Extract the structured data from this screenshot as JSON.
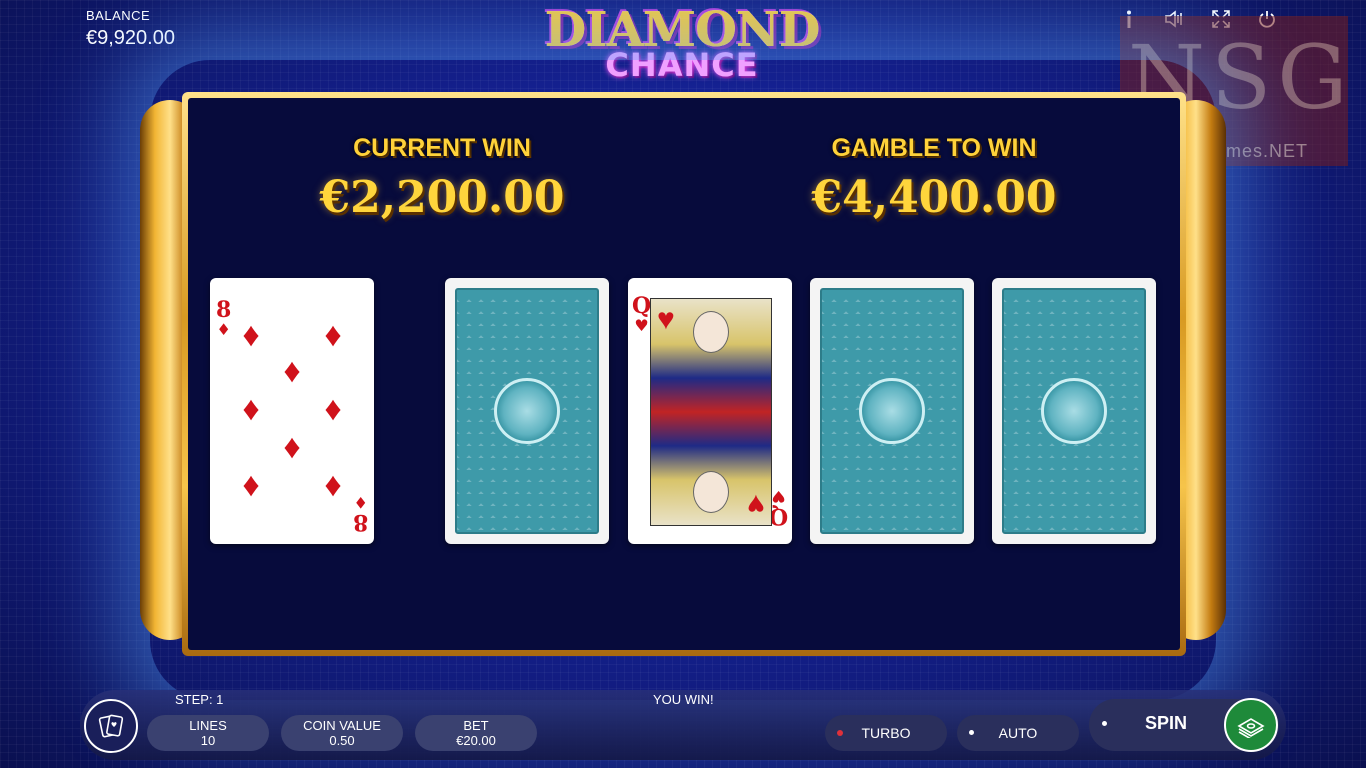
{
  "balance": {
    "label": "BALANCE",
    "value": "€9,920.00"
  },
  "top_icons": [
    "info-icon",
    "sound-icon",
    "fullscreen-icon",
    "power-icon"
  ],
  "logo": {
    "line1": "DIAMOND",
    "line2": "CHANCE"
  },
  "gamble": {
    "current_win_label": "CURRENT WIN",
    "current_win_value": "€2,200.00",
    "gamble_label": "GAMBLE TO WIN",
    "gamble_value": "€4,400.00"
  },
  "cards": {
    "dealer": {
      "rank": "8",
      "suit": "♦"
    },
    "choices": [
      {
        "state": "face-down"
      },
      {
        "state": "face-up",
        "rank": "Q",
        "suit": "♥"
      },
      {
        "state": "face-down"
      },
      {
        "state": "face-down"
      }
    ]
  },
  "status": {
    "step": "STEP: 1",
    "message": "YOU WIN!"
  },
  "controls": {
    "lines_label": "LINES",
    "lines_value": "10",
    "coin_label": "COIN VALUE",
    "coin_value": "0.50",
    "bet_label": "BET",
    "bet_value": "€20.00",
    "turbo_label": "TURBO",
    "auto_label": "AUTO",
    "spin_label": "SPIN"
  },
  "watermark": {
    "letters": "NSG",
    "site": "NewSlotGames.NET"
  },
  "colors": {
    "gold": "#ffd23a",
    "card_red": "#d0121b",
    "card_back": "#3e9aa9",
    "spin_green": "#1e8a3a"
  }
}
